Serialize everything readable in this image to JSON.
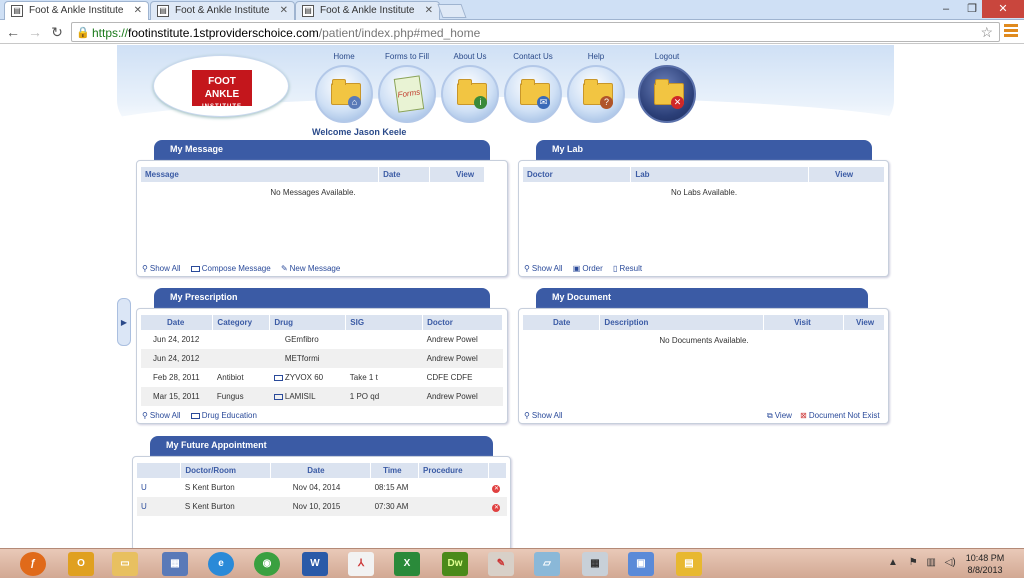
{
  "browser": {
    "tabs": [
      {
        "title": "Foot & Ankle Institute",
        "active": true
      },
      {
        "title": "Foot & Ankle Institute",
        "active": false
      },
      {
        "title": "Foot & Ankle Institute",
        "active": false
      }
    ],
    "url": {
      "scheme": "https://",
      "host": "footinstitute.1stproviderschoice.com",
      "path": "/patient/index.php#med_home"
    },
    "reader_button": "Aa"
  },
  "header": {
    "logo_top": "FOOT ANKLE",
    "logo_bottom": "INSTITUTE",
    "nav": [
      {
        "label": "Home",
        "icon": "home-folder-icon"
      },
      {
        "label": "Forms to Fill",
        "icon": "forms-icon",
        "badge": "Forms"
      },
      {
        "label": "About Us",
        "icon": "about-folder-icon"
      },
      {
        "label": "Contact Us",
        "icon": "contact-folder-icon"
      },
      {
        "label": "Help",
        "icon": "help-folder-icon"
      },
      {
        "label": "Logout",
        "icon": "logout-folder-icon"
      }
    ],
    "welcome": "Welcome Jason Keele"
  },
  "my_message": {
    "title": "My Message",
    "columns": [
      "Message",
      "Date",
      "View"
    ],
    "empty": "No Messages Available.",
    "links": [
      "Show All",
      "Compose Message",
      "New Message"
    ]
  },
  "my_lab": {
    "title": "My Lab",
    "columns": [
      "Doctor",
      "Lab",
      "View"
    ],
    "empty": "No Labs Available.",
    "links": [
      "Show All",
      "Order",
      "Result"
    ]
  },
  "my_prescription": {
    "title": "My Prescription",
    "columns": [
      "Date",
      "Category",
      "Drug",
      "SIG",
      "Doctor"
    ],
    "rows": [
      {
        "date": "Jun 24, 2012",
        "category": "",
        "drug": "GEmfibro",
        "sig": "",
        "doctor": "Andrew Powel"
      },
      {
        "date": "Jun 24, 2012",
        "category": "",
        "drug": "METformi",
        "sig": "",
        "doctor": "Andrew Powel"
      },
      {
        "date": "Feb 28, 2011",
        "category": "Antibiot",
        "drug": "ZYVOX 60",
        "sig": "Take 1 t",
        "doctor": "CDFE CDFE"
      },
      {
        "date": "Mar 15, 2011",
        "category": "Fungus",
        "drug": "LAMISIL",
        "sig": "1 PO qd",
        "doctor": "Andrew Powel"
      }
    ],
    "links": [
      "Show All",
      "Drug Education"
    ]
  },
  "my_document": {
    "title": "My Document",
    "columns": [
      "Date",
      "Description",
      "Visit",
      "View"
    ],
    "empty": "No Documents Available.",
    "links_left": [
      "Show All"
    ],
    "links_right": [
      "View",
      "Document Not Exist"
    ]
  },
  "my_appointment": {
    "title": "My Future Appointment",
    "columns": [
      "",
      "Doctor/Room",
      "Date",
      "Time",
      "Procedure",
      ""
    ],
    "rows": [
      {
        "flag": "U",
        "doctor": "S Kent Burton",
        "date": "Nov 04, 2014",
        "time": "08:15 AM",
        "procedure": ""
      },
      {
        "flag": "U",
        "doctor": "S Kent Burton",
        "date": "Nov 10, 2015",
        "time": "07:30 AM",
        "procedure": ""
      }
    ]
  },
  "taskbar": {
    "apps": [
      "firefox-icon",
      "outlook-icon",
      "explorer-icon",
      "network-icon",
      "ie-icon",
      "chrome-icon",
      "word-icon",
      "acrobat-icon",
      "excel-icon",
      "dreamweaver-icon",
      "paint-icon",
      "notes-icon",
      "calculator-icon",
      "remote-icon",
      "archive-icon"
    ],
    "clock_time": "10:48 PM",
    "clock_date": "8/8/2013"
  }
}
